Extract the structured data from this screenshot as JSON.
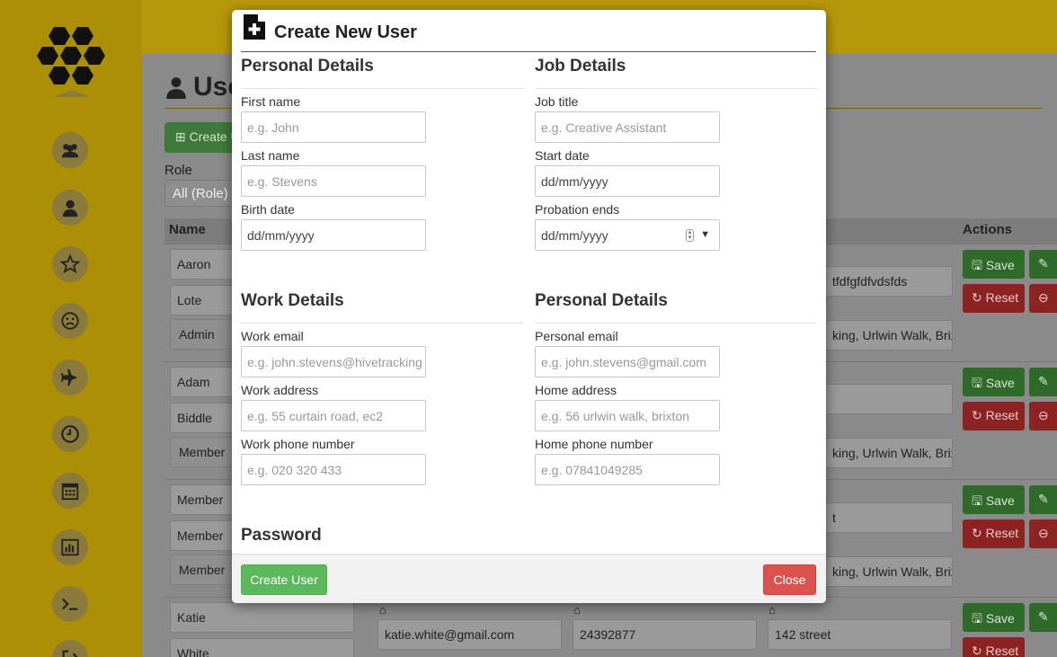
{
  "background": {
    "page_title": "Use",
    "create_button_label": "⊞ Create U",
    "role_label": "Role",
    "role_select_value": "All (Role)",
    "columns": {
      "name": "Name",
      "actions": "Actions"
    },
    "rows": [
      {
        "first": "Aaron",
        "last": "Lote",
        "role": "Admin",
        "right_top": "tfdfgfdfvdsfds",
        "right_bottom": "king, Urlwin Walk, Brix",
        "save": "Save",
        "reset": "Reset"
      },
      {
        "first": "Adam",
        "last": "Biddle",
        "role": "Member",
        "right_top": "",
        "right_bottom": "king, Urlwin Walk, Brix",
        "save": "Save",
        "reset": "Reset"
      },
      {
        "first": "Member",
        "last": "Member",
        "role": "Member",
        "right_top": "t",
        "right_bottom": "king, Urlwin Walk, Brix",
        "save": "Save",
        "reset": "Reset"
      },
      {
        "first": "Katie",
        "last": "White",
        "role": "",
        "email": "katie.white@gmail.com",
        "phone": "24392877",
        "street": "142 street",
        "save": "Save",
        "reset": "Reset"
      }
    ],
    "sidebar_icons": [
      "users-icon",
      "user-icon",
      "star-icon",
      "frown-icon",
      "plane-icon",
      "clock-icon",
      "calendar-icon",
      "bar-chart-icon",
      "terminal-icon",
      "sign-out-icon"
    ]
  },
  "modal": {
    "title": "Create New User",
    "sections": {
      "personal": {
        "title": "Personal Details",
        "first_name_label": "First name",
        "first_name_placeholder": "e.g. John",
        "last_name_label": "Last name",
        "last_name_placeholder": "e.g. Stevens",
        "birth_date_label": "Birth date",
        "birth_date_value": "dd/mm/yyyy"
      },
      "job": {
        "title": "Job Details",
        "job_title_label": "Job title",
        "job_title_placeholder": "e.g. Creative Assistant",
        "start_date_label": "Start date",
        "start_date_value": "dd/mm/yyyy",
        "probation_label": "Probation ends",
        "probation_value": "dd/mm/yyyy"
      },
      "work": {
        "title": "Work Details",
        "email_label": "Work email",
        "email_placeholder": "e.g. john.stevens@hivetracking",
        "address_label": "Work address",
        "address_placeholder": "e.g. 55 curtain road, ec2",
        "phone_label": "Work phone number",
        "phone_placeholder": "e.g. 020 320 433"
      },
      "personal_contact": {
        "title": "Personal Details",
        "email_label": "Personal email",
        "email_placeholder": "e.g. john.stevens@gmail.com",
        "address_label": "Home address",
        "address_placeholder": "e.g. 56 urlwin walk, brixton",
        "phone_label": "Home phone number",
        "phone_placeholder": "e.g. 07841049285"
      },
      "password": {
        "title": "Password"
      }
    },
    "footer": {
      "create_label": "Create User",
      "close_label": "Close"
    }
  },
  "colors": {
    "accent_yellow": "#b8980b",
    "success": "#5cb85c",
    "danger": "#d9534f"
  }
}
